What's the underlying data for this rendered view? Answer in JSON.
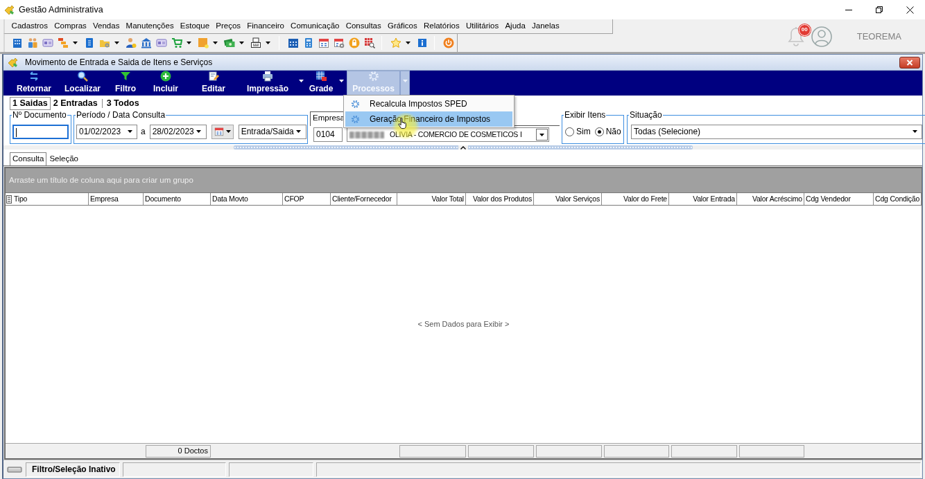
{
  "window": {
    "title": "Gestão Administrativa"
  },
  "menu": [
    "Cadastros",
    "Compras",
    "Vendas",
    "Manutenções",
    "Estoque",
    "Preços",
    "Financeiro",
    "Comunicação",
    "Consultas",
    "Gráficos",
    "Relatórios",
    "Utilitários",
    "Ajuda",
    "Janelas"
  ],
  "notifications": {
    "count": "00"
  },
  "user": {
    "name": "TEOREMA"
  },
  "form": {
    "title": "Movimento de Entrada e Saida de Itens e Serviços",
    "actions": [
      {
        "label": "Retornar",
        "dropdown": false,
        "expanded": false
      },
      {
        "label": "Localizar",
        "dropdown": false,
        "expanded": false
      },
      {
        "label": "Filtro",
        "dropdown": false,
        "expanded": false
      },
      {
        "label": "Incluir",
        "dropdown": false,
        "expanded": false
      },
      {
        "label": "Editar",
        "dropdown": false,
        "expanded": false
      },
      {
        "label": "Impressão",
        "dropdown": true,
        "expanded": false
      },
      {
        "label": "Grade",
        "dropdown": true,
        "expanded": false
      },
      {
        "label": "Processos",
        "dropdown": true,
        "expanded": true
      }
    ],
    "actions_menu": [
      {
        "label": "Recalcula Impostos SPED",
        "selected": false
      },
      {
        "label": "Geração Financeiro de Impostos",
        "selected": true
      }
    ],
    "mode_tabs": [
      {
        "label": "1 Saidas",
        "selected": true
      },
      {
        "label": "2 Entradas",
        "selected": false
      },
      {
        "label": "3 Todos",
        "selected": false
      }
    ],
    "filters": {
      "document": {
        "label": "Nº Documento",
        "focused": true
      },
      "period": {
        "label": "Período / Data Consulta",
        "from": "01/02/2023",
        "separator": "a",
        "to": "28/02/2023",
        "movement": "Entrada/Saida"
      },
      "company": {
        "label": "Empresa",
        "code": "0104",
        "name": "OLIVIA - COMERCIO DE COSMETICOS I"
      },
      "show_items": {
        "label": "Exibir Itens",
        "options": [
          {
            "label": "Sim",
            "selected": false
          },
          {
            "label": "Não",
            "selected": true
          }
        ]
      },
      "status": {
        "label": "Situação",
        "value": "Todas (Selecione)"
      }
    },
    "view_tabs": [
      {
        "label": "Consulta",
        "selected": true
      },
      {
        "label": "Seleção",
        "selected": false
      }
    ],
    "grid": {
      "group_hint": "Arraste um título de coluna aqui para criar um grupo",
      "columns": [
        {
          "label": "Tipo",
          "kind": "text"
        },
        {
          "label": "Empresa",
          "kind": "text"
        },
        {
          "label": "Documento",
          "kind": "text",
          "footer": "0 Doctos"
        },
        {
          "label": "Data Movto",
          "kind": "text"
        },
        {
          "label": "CFOP",
          "kind": "text"
        },
        {
          "label": "Cliente/Fornecedor",
          "kind": "text"
        },
        {
          "label": "Valor Total",
          "kind": "amount"
        },
        {
          "label": "Valor dos Produtos",
          "kind": "amount"
        },
        {
          "label": "Valor Serviços",
          "kind": "amount"
        },
        {
          "label": "Valor do Frete",
          "kind": "amount"
        },
        {
          "label": "Valor Entrada",
          "kind": "amount"
        },
        {
          "label": "Valor Acréscimo",
          "kind": "amount"
        },
        {
          "label": "Cdg Vendedor",
          "kind": "text"
        },
        {
          "label": "Cdg Condição",
          "kind": "text"
        }
      ],
      "empty_text": "< Sem Dados para Exibir >"
    },
    "status_bar": {
      "filter_state": "Filtro/Seleção Inativo"
    }
  }
}
